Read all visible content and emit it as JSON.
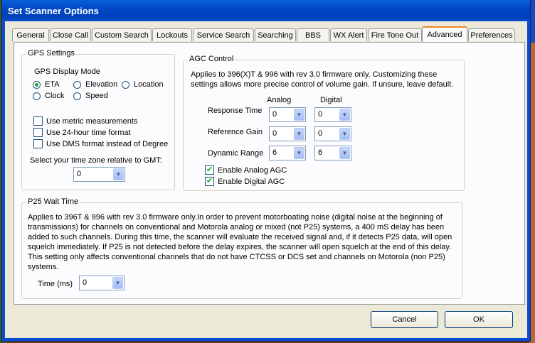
{
  "window": {
    "title": "Set Scanner Options"
  },
  "tabs": [
    {
      "label": "General"
    },
    {
      "label": "Close Call"
    },
    {
      "label": "Custom Search"
    },
    {
      "label": "Lockouts"
    },
    {
      "label": "Service Search"
    },
    {
      "label": "Searching"
    },
    {
      "label": "BBS"
    },
    {
      "label": "WX Alert"
    },
    {
      "label": "Fire Tone Out"
    },
    {
      "label": "Advanced"
    },
    {
      "label": "Preferences"
    }
  ],
  "active_tab": "Advanced",
  "gps": {
    "legend": "GPS Settings",
    "display_mode_label": "GPS Display Mode",
    "modes": [
      {
        "label": "ETA",
        "selected": true
      },
      {
        "label": "Elevation",
        "selected": false
      },
      {
        "label": "Location",
        "selected": false
      },
      {
        "label": "Clock",
        "selected": false
      },
      {
        "label": "Speed",
        "selected": false
      }
    ],
    "options": [
      {
        "label": "Use metric measurements",
        "checked": false
      },
      {
        "label": "Use 24-hour time format",
        "checked": false
      },
      {
        "label": "Use DMS format instead of Degree",
        "checked": false
      }
    ],
    "timezone_label": "Select your time zone relative to GMT:",
    "timezone_value": "0"
  },
  "agc": {
    "legend": "AGC Control",
    "description": "Applies to 396(X)T & 996 with rev 3.0 firmware only. Customizing these settings allows more precise control of volume gain. If unsure, leave default.",
    "col_analog": "Analog",
    "col_digital": "Digital",
    "rows": [
      {
        "label": "Response Time",
        "analog": "0",
        "digital": "0"
      },
      {
        "label": "Reference Gain",
        "analog": "0",
        "digital": "0"
      },
      {
        "label": "Dynamic Range",
        "analog": "6",
        "digital": "6"
      }
    ],
    "enable_analog": {
      "label": "Enable Analog AGC",
      "checked": true
    },
    "enable_digital": {
      "label": "Enable Digital AGC",
      "checked": true
    }
  },
  "p25": {
    "legend": "P25 Wait Time",
    "description": "Applies to 396T & 996 with rev 3.0 firmware only.In order to prevent motorboating noise (digital noise at the beginning of transmissions) for channels on conventional and Motorola analog or mixed (not P25) systems, a 400 mS delay has been added to such channels. During this time, the scanner will evaluate the received signal and, if it detects P25 data, will open squelch immediately. If P25 is not detected before the delay expires, the scanner will open squelch at the end of this delay. This setting only affects conventional channels that do not have CTCSS or DCS set and channels on Motorola (non P25) systems.",
    "time_label": "Time (ms)",
    "time_value": "0"
  },
  "buttons": {
    "cancel": "Cancel",
    "ok": "OK"
  },
  "colors": {
    "titlebar": "#0048c8",
    "tab_accent": "#e68b2c",
    "check_green": "#21a121"
  }
}
